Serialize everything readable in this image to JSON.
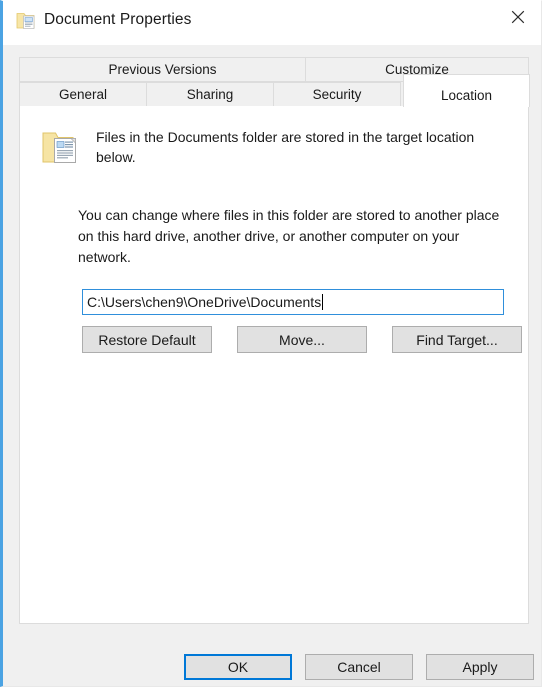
{
  "window": {
    "title": "Document Properties",
    "icon": "folder-document-icon",
    "close_label": "✕",
    "accent_color": "#0078d7",
    "frame_accent_color": "#4ba3e3",
    "titlebar_bg": "#ffffff",
    "dialog_bg": "#f0f0f0",
    "panel_bg": "#ffffff"
  },
  "tabs": {
    "row1": [
      {
        "label": "Previous Versions",
        "selected": false
      },
      {
        "label": "Customize",
        "selected": false
      }
    ],
    "row2": [
      {
        "label": "General",
        "selected": false
      },
      {
        "label": "Sharing",
        "selected": false
      },
      {
        "label": "Security",
        "selected": false
      }
    ],
    "selected_tab": {
      "label": "Location",
      "selected": true
    }
  },
  "location_tab": {
    "info_icon": "folder-document-icon",
    "info_text": "Files in the Documents folder are stored in the target location below.",
    "description_text": "You can change where files in this folder are stored to another place on this hard drive, another drive, or another computer on your network.",
    "path_field": {
      "value": "C:\\Users\\chen9\\OneDrive\\Documents",
      "placeholder": "",
      "focused": true,
      "border_color": "#2f8fdb"
    },
    "buttons": [
      {
        "label": "Restore Default"
      },
      {
        "label": "Move..."
      },
      {
        "label": "Find Target..."
      }
    ]
  },
  "dialog_buttons": [
    {
      "label": "OK",
      "default": true
    },
    {
      "label": "Cancel",
      "default": false
    },
    {
      "label": "Apply",
      "default": false
    }
  ]
}
